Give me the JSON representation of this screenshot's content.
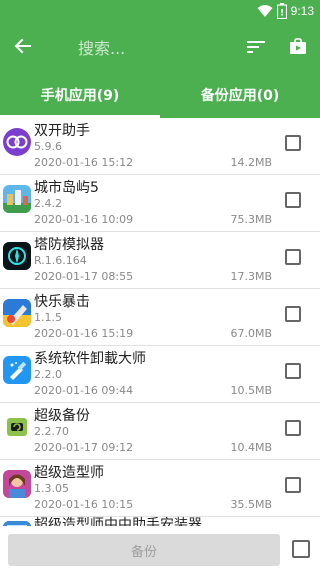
{
  "status_bar": {
    "time": "9:13",
    "icons": [
      "wifi-icon",
      "battery-icon"
    ]
  },
  "toolbar": {
    "back_icon": "arrow-back-icon",
    "search_placeholder": "搜索...",
    "sort_icon": "sort-icon",
    "store_icon": "shopping-bag-icon"
  },
  "tabs": [
    {
      "label": "手机应用(9)",
      "active": true
    },
    {
      "label": "备份应用(0)",
      "active": false
    }
  ],
  "apps": [
    {
      "name": "双开助手",
      "version": "5.9.6",
      "date": "2020-01-16 15:12",
      "size": "14.2MB",
      "icon": "dual-app-icon",
      "checked": false
    },
    {
      "name": "城市岛屿5",
      "version": "2.4.2",
      "date": "2020-01-16 10:09",
      "size": "75.3MB",
      "icon": "city-island-icon",
      "checked": false
    },
    {
      "name": "塔防模拟器",
      "version": "R.1.6.164",
      "date": "2020-01-17 08:55",
      "size": "17.3MB",
      "icon": "tower-defense-icon",
      "checked": false
    },
    {
      "name": "快乐暴击",
      "version": "1.1.5",
      "date": "2020-01-16 15:19",
      "size": "67.0MB",
      "icon": "happy-crit-icon",
      "checked": false
    },
    {
      "name": "系统软件卸載大师",
      "version": "2.2.0",
      "date": "2020-01-16 09:44",
      "size": "10.5MB",
      "icon": "uninstaller-icon",
      "checked": false
    },
    {
      "name": "超级备份",
      "version": "2.2.70",
      "date": "2020-01-17 09:12",
      "size": "10.4MB",
      "icon": "super-backup-icon",
      "checked": false
    },
    {
      "name": "超级造型师",
      "version": "1.3.05",
      "date": "2020-01-16 10:15",
      "size": "35.5MB",
      "icon": "stylist-icon",
      "checked": false
    },
    {
      "name": "超级造型师中中助手安装器",
      "version": "",
      "date": "",
      "size": "",
      "icon": "installer-icon",
      "checked": false
    }
  ],
  "bottom": {
    "backup_label": "备份",
    "select_all_checked": false
  },
  "colors": {
    "primary": "#4caf50",
    "divider": "#e2e2e2",
    "secondary_text": "#8a8a8a"
  }
}
